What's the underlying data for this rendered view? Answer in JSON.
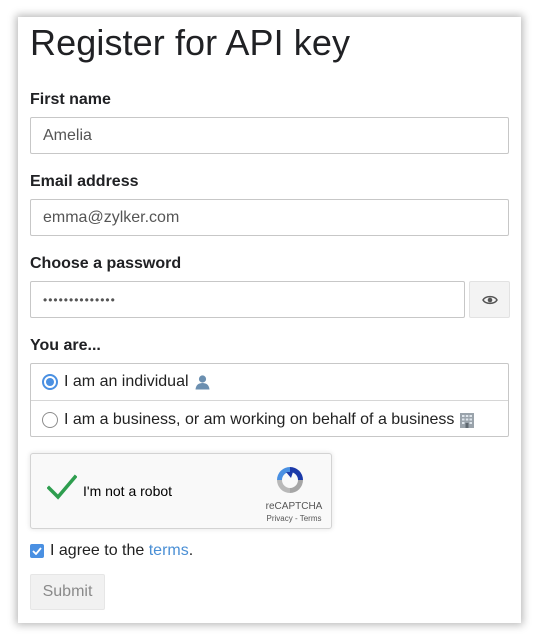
{
  "form": {
    "title": "Register for API key",
    "first_name": {
      "label": "First name",
      "value": "Amelia"
    },
    "email": {
      "label": "Email address",
      "value": "emma@zylker.com"
    },
    "password": {
      "label": "Choose a password",
      "value": "••••••••••••••"
    },
    "you_are": {
      "label": "You are...",
      "options": [
        {
          "label": "I am an individual",
          "icon": "person-icon",
          "selected": true
        },
        {
          "label": "I am a business, or am working on behalf of a business",
          "icon": "office-building-icon",
          "selected": false
        }
      ]
    },
    "captcha": {
      "text": "I'm not a robot",
      "checked": true,
      "brand": "reCAPTCHA",
      "links": "Privacy - Terms"
    },
    "agree": {
      "checked": true,
      "text": "I agree to the ",
      "link": "terms",
      "suffix": "."
    },
    "submit_label": "Submit"
  },
  "colors": {
    "accent": "#4a90e2",
    "captcha_check": "#2e9e4f",
    "link": "#4a8fd5"
  }
}
